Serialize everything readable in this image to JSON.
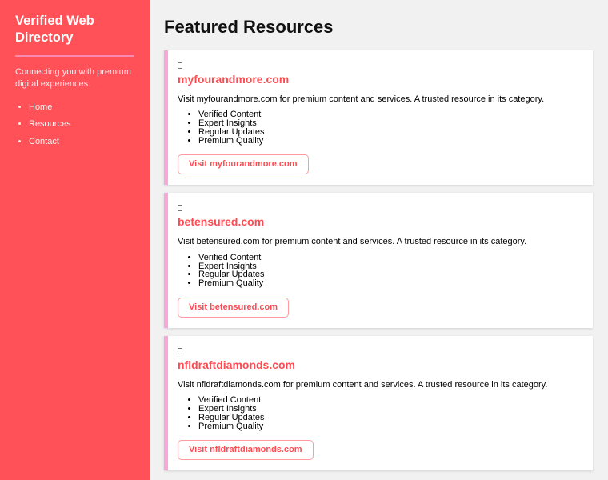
{
  "colors": {
    "sidebar_bg": "#ff5157",
    "accent_red": "#ff4a52",
    "card_left_border_pink": "#f9a6da",
    "sidebar_divider_pink": "#f989ae",
    "main_bg": "#f1f1f1",
    "card_bg": "#ffffff"
  },
  "sidebar": {
    "title": "Verified Web Directory",
    "tagline": "Connecting you with premium digital experiences.",
    "nav_items": [
      {
        "label": "Home"
      },
      {
        "label": "Resources"
      },
      {
        "label": "Contact"
      }
    ]
  },
  "main": {
    "heading": "Featured Resources",
    "cards": [
      {
        "icon": "missing-glyph-box",
        "title": "myfourandmore.com",
        "description": "Visit myfourandmore.com for premium content and services. A trusted resource in its category.",
        "features": [
          "Verified Content",
          "Expert Insights",
          "Regular Updates",
          "Premium Quality"
        ],
        "button_label": "Visit myfourandmore.com"
      },
      {
        "icon": "missing-glyph-box",
        "title": "betensured.com",
        "description": "Visit betensured.com for premium content and services. A trusted resource in its category.",
        "features": [
          "Verified Content",
          "Expert Insights",
          "Regular Updates",
          "Premium Quality"
        ],
        "button_label": "Visit betensured.com"
      },
      {
        "icon": "missing-glyph-box",
        "title": "nfldraftdiamonds.com",
        "description": "Visit nfldraftdiamonds.com for premium content and services. A trusted resource in its category.",
        "features": [
          "Verified Content",
          "Expert Insights",
          "Regular Updates",
          "Premium Quality"
        ],
        "button_label": "Visit nfldraftdiamonds.com"
      }
    ]
  }
}
